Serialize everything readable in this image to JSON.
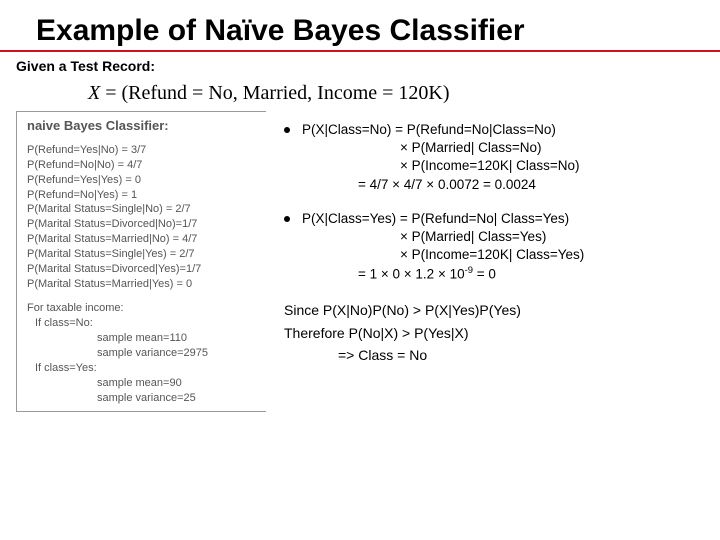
{
  "title": "Example of Naïve Bayes Classifier",
  "subtitle": "Given a Test Record:",
  "formula_x": "X",
  "formula_eq": " = (Refund = No, Married, Income = 120K)",
  "left": {
    "header": "naive Bayes Classifier:",
    "lines": [
      "P(Refund=Yes|No) = 3/7",
      "P(Refund=No|No) = 4/7",
      "P(Refund=Yes|Yes) = 0",
      "P(Refund=No|Yes) = 1",
      "P(Marital Status=Single|No) = 2/7",
      "P(Marital Status=Divorced|No)=1/7",
      "P(Marital Status=Married|No) = 4/7",
      "P(Marital Status=Single|Yes) = 2/7",
      "P(Marital Status=Divorced|Yes)=1/7",
      "P(Marital Status=Married|Yes) = 0"
    ],
    "income_header": "For taxable income:",
    "inc_no_label": "If class=No:",
    "inc_no_mean": "sample mean=110",
    "inc_no_var": "sample variance=2975",
    "inc_yes_label": "If class=Yes:",
    "inc_yes_mean": "sample mean=90",
    "inc_yes_var": "sample variance=25"
  },
  "right": {
    "no": {
      "l1": "P(X|Class=No) = P(Refund=No|Class=No)",
      "l2": "× P(Married| Class=No)",
      "l3": "× P(Income=120K| Class=No)",
      "l4": "= 4/7 × 4/7 × 0.0072 = 0.0024"
    },
    "yes": {
      "l1": "P(X|Class=Yes) = P(Refund=No| Class=Yes)",
      "l2": "× P(Married| Class=Yes)",
      "l3": "× P(Income=120K| Class=Yes)",
      "l4a": "= 1 × 0 × 1.2 × 10",
      "l4b": " = 0",
      "exp": "-9"
    },
    "concl1": "Since P(X|No)P(No) > P(X|Yes)P(Yes)",
    "concl2": "Therefore P(No|X) > P(Yes|X)",
    "concl3": "=> Class = No"
  }
}
